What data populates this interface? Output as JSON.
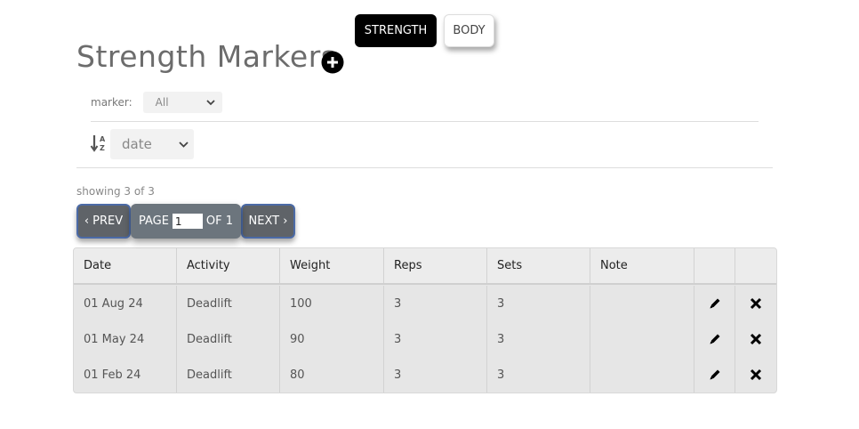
{
  "nav": {
    "strength_label": "STRENGTH",
    "body_label": "BODY"
  },
  "header": {
    "title": "Strength Markers"
  },
  "filter": {
    "label": "marker:",
    "value": "All"
  },
  "sort": {
    "value": "date"
  },
  "summary": {
    "showing": "showing 3 of 3"
  },
  "pager": {
    "prev_label": "‹ PREV",
    "page_label": "PAGE",
    "page_value": "1",
    "of_label": "OF 1",
    "next_label": "NEXT ›"
  },
  "table": {
    "headers": [
      "Date",
      "Activity",
      "Weight",
      "Reps",
      "Sets",
      "Note"
    ],
    "rows": [
      [
        "01 Aug 24",
        "Deadlift",
        "100",
        "3",
        "3",
        ""
      ],
      [
        "01 May 24",
        "Deadlift",
        "90",
        "3",
        "3",
        ""
      ],
      [
        "01 Feb 24",
        "Deadlift",
        "80",
        "3",
        "3",
        ""
      ]
    ]
  },
  "icons": {
    "add": "plus-circle-icon",
    "sort": "sort-alpha-down-icon",
    "edit": "pencil-icon",
    "delete": "x-icon",
    "dropdown": "chevron-down-icon"
  }
}
